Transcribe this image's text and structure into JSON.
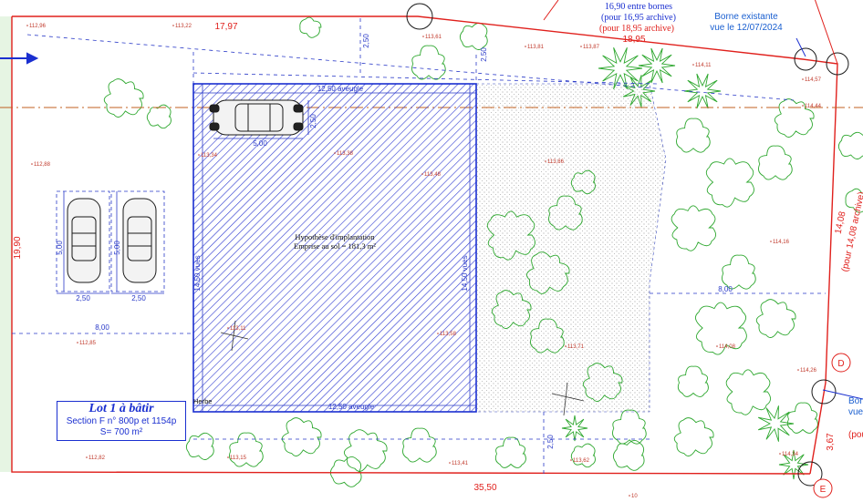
{
  "plan": {
    "implantation": {
      "title": "Hypothèse d'implantation",
      "subtitle": "Emprise au sol = 181,3 m²"
    },
    "lot": {
      "title": "Lot 1 à bâtir",
      "section": "Section F n° 800p et 1154p",
      "area": "S= 700 m²"
    },
    "borne_note": {
      "line1": "Borne existante",
      "line2": "vue le 12/07/2024"
    },
    "borne_note_partial": {
      "line1": "Borne",
      "line2": "vue",
      "line3": "(pour"
    },
    "distance_note": {
      "line1": "16,90 entre bornes",
      "line2": "(pour 16,95 archive)",
      "line3": "(pour 18,95 archive)",
      "line4": "18,95"
    },
    "side_note": "(pour 14,08 archive)",
    "side_value": "14,08",
    "label_herbe": "Herbe",
    "borne_D": "D",
    "borne_E": "E",
    "dims": {
      "top_frontage": "17,97",
      "bottom_frontage": "35,50",
      "left_side": "19,90",
      "right_small": "3,67",
      "setback_top": "2,50",
      "setback_top2": "2,50",
      "setback_bottom": "2,50",
      "house_width_top": "12,50 aveugle",
      "house_width_bottom": "12,50 aveugle",
      "house_depth_left": "14,50 vues",
      "house_depth_right": "14,50 vues",
      "dist_left": "8,00",
      "dist_right": "8,00",
      "car_len": "5,00",
      "car_wid": "2,50",
      "park_len1": "5,00",
      "park_len2": "5,00",
      "park_w1": "2,50",
      "park_w2": "2,50"
    },
    "elevations": [
      "112,96",
      "113,22",
      "113,61",
      "113,81",
      "113,87",
      "114,11",
      "114,57",
      "114,44",
      "112,88",
      "113,34",
      "113,38",
      "113,48",
      "113,86",
      "114,16",
      "112,85",
      "113,11",
      "113,58",
      "113,71",
      "114,08",
      "114,26",
      "112,82",
      "113,15",
      "113,41",
      "113,62",
      "114,34",
      "10"
    ],
    "colors": {
      "boundary": "#e0201c",
      "blue": "#1a2fd0",
      "vegetation": "#2fa830",
      "dimension": "#2a3ac8",
      "elevation": "#c0392b",
      "axis": "#c06020"
    }
  }
}
